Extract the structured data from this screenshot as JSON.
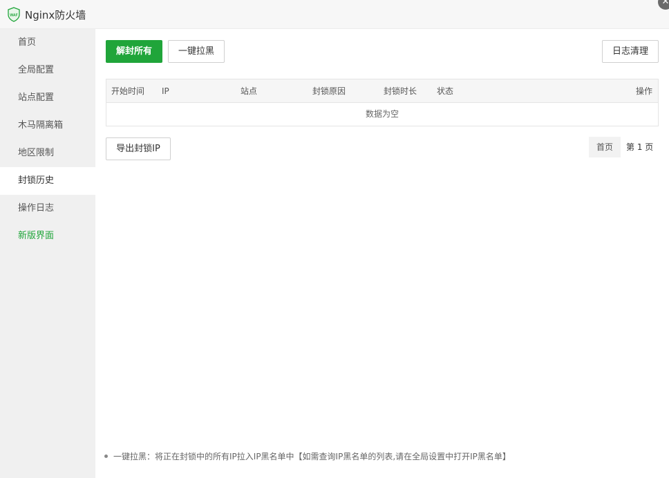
{
  "window": {
    "title": "Nginx防火墙"
  },
  "sidebar": {
    "items": [
      {
        "label": "首页"
      },
      {
        "label": "全局配置"
      },
      {
        "label": "站点配置"
      },
      {
        "label": "木马隔离箱"
      },
      {
        "label": "地区限制"
      },
      {
        "label": "封锁历史"
      },
      {
        "label": "操作日志"
      },
      {
        "label": "新版界面"
      }
    ],
    "active_index": 5
  },
  "toolbar": {
    "unblock_all_label": "解封所有",
    "blacklist_label": "一键拉黑",
    "clear_log_label": "日志清理"
  },
  "table": {
    "columns": [
      "开始时间",
      "IP",
      "站点",
      "封锁原因",
      "封锁时长",
      "状态",
      "操作"
    ],
    "empty_text": "数据为空"
  },
  "export": {
    "label": "导出封锁IP"
  },
  "pagination": {
    "first_label": "首页",
    "page_info": "第 1 页"
  },
  "help": {
    "items": [
      "一键拉黑：将正在封锁中的所有IP拉入IP黑名单中【如需查询IP黑名单的列表,请在全局设置中打开IP黑名单】"
    ]
  },
  "colors": {
    "accent": "#20a53a",
    "sidebar_bg": "#f0f0f0"
  },
  "icons": {
    "logo": "waf-shield-icon",
    "close": "close-icon"
  }
}
